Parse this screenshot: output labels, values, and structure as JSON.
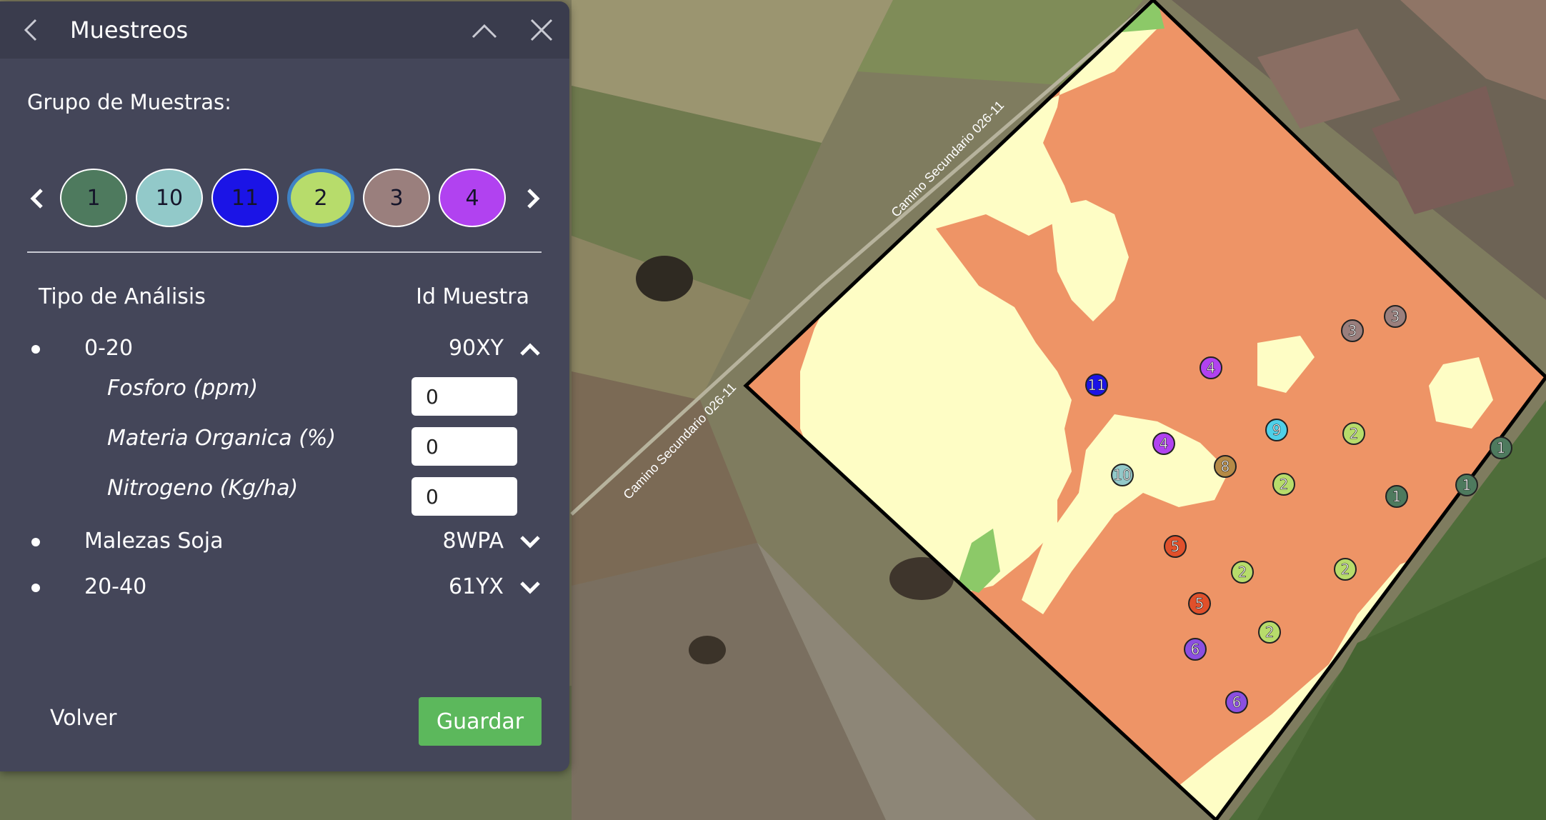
{
  "panel": {
    "title": "Muestreos",
    "group_label": "Grupo de Muestras:",
    "groups": [
      {
        "label": "1",
        "color": "#4e7a5e",
        "selected": false
      },
      {
        "label": "10",
        "color": "#92c9c9",
        "selected": false
      },
      {
        "label": "11",
        "color": "#1b14e6",
        "selected": false
      },
      {
        "label": "2",
        "color": "#b7dc6b",
        "selected": true
      },
      {
        "label": "3",
        "color": "#9a7f7d",
        "selected": false
      },
      {
        "label": "4",
        "color": "#b142f0",
        "selected": false
      }
    ],
    "columns": {
      "type": "Tipo de Análisis",
      "id": "Id Muestra"
    },
    "analyses": [
      {
        "name": "0-20",
        "id": "90XY",
        "expanded": true,
        "fields": [
          {
            "label": "Fosforo (ppm)",
            "value": "0"
          },
          {
            "label": "Materia Organica (%)",
            "value": "0"
          },
          {
            "label": "Nitrogeno (Kg/ha)",
            "value": "0"
          }
        ]
      },
      {
        "name": "Malezas Soja",
        "id": "8WPA",
        "expanded": false
      },
      {
        "name": "20-40",
        "id": "61YX",
        "expanded": false
      }
    ],
    "back_label": "Volver",
    "save_label": "Guardar"
  },
  "map": {
    "road_labels": [
      "Camino Secundario 026-11",
      "Camino Secundario 026-11"
    ],
    "zone_colors": {
      "high": "#ee9466",
      "low": "#fefdc5",
      "green": "#8cc968"
    },
    "markers": [
      {
        "label": "11",
        "color": "#1b14e6"
      },
      {
        "label": "4",
        "color": "#b142f0"
      },
      {
        "label": "4",
        "color": "#b142f0"
      },
      {
        "label": "3",
        "color": "#9a7f7d"
      },
      {
        "label": "3",
        "color": "#9a7f7d"
      },
      {
        "label": "9",
        "color": "#4fd0e8"
      },
      {
        "label": "2",
        "color": "#b7dc6b"
      },
      {
        "label": "10",
        "color": "#92c9c9"
      },
      {
        "label": "8",
        "color": "#b58a46"
      },
      {
        "label": "2",
        "color": "#b7dc6b"
      },
      {
        "label": "1",
        "color": "#4e7a5e"
      },
      {
        "label": "1",
        "color": "#4e7a5e"
      },
      {
        "label": "1",
        "color": "#4e7a5e"
      },
      {
        "label": "5",
        "color": "#e0502b"
      },
      {
        "label": "2",
        "color": "#b7dc6b"
      },
      {
        "label": "2",
        "color": "#b7dc6b"
      },
      {
        "label": "5",
        "color": "#e0502b"
      },
      {
        "label": "2",
        "color": "#b7dc6b"
      },
      {
        "label": "6",
        "color": "#8b4fe0"
      },
      {
        "label": "6",
        "color": "#8b4fe0"
      }
    ]
  }
}
